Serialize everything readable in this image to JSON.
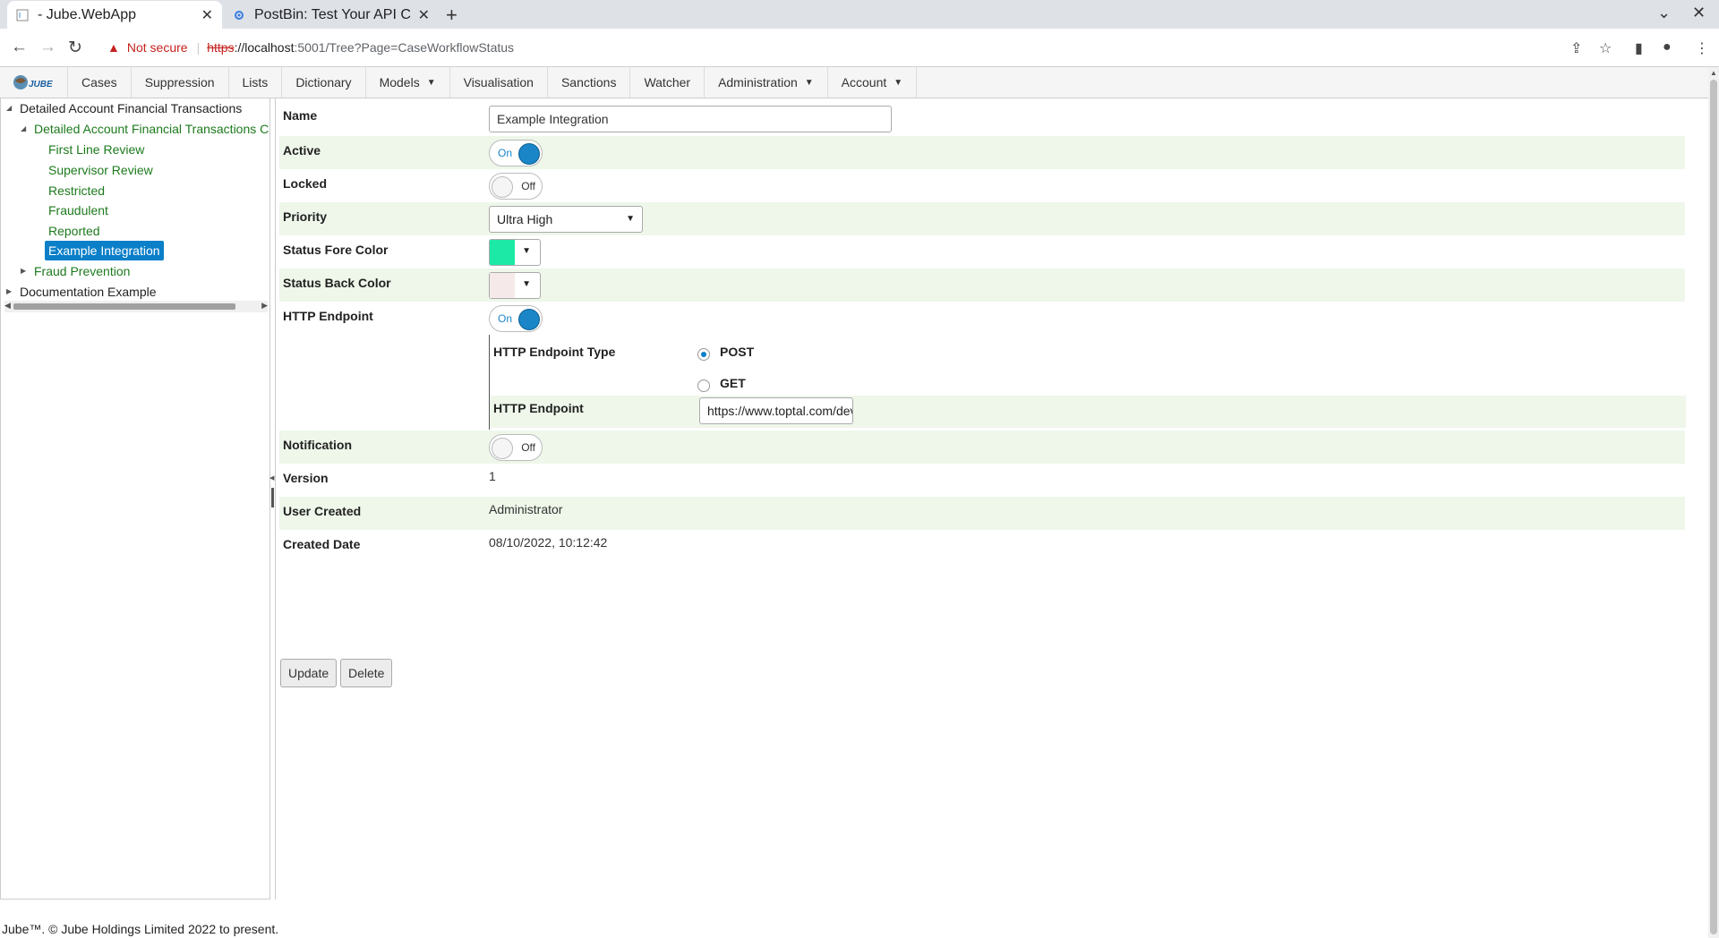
{
  "browser": {
    "tabs": [
      {
        "title": "- Jube.WebApp",
        "active": true
      },
      {
        "title": "PostBin: Test Your API Clie",
        "active": false
      }
    ],
    "warning": "Not secure",
    "url_scheme": "https",
    "url_host": "://localhost",
    "url_rest": ":5001/Tree?Page=CaseWorkflowStatus"
  },
  "menu": {
    "logo_text": "JUBE",
    "items": [
      {
        "label": "Cases",
        "dropdown": false
      },
      {
        "label": "Suppression",
        "dropdown": false
      },
      {
        "label": "Lists",
        "dropdown": false
      },
      {
        "label": "Dictionary",
        "dropdown": false
      },
      {
        "label": "Models",
        "dropdown": true
      },
      {
        "label": "Visualisation",
        "dropdown": false
      },
      {
        "label": "Sanctions",
        "dropdown": false
      },
      {
        "label": "Watcher",
        "dropdown": false
      },
      {
        "label": "Administration",
        "dropdown": true
      },
      {
        "label": "Account",
        "dropdown": true
      }
    ]
  },
  "tree": {
    "root": "Detailed Account Financial Transactions",
    "child": "Detailed Account Financial Transactions Ca",
    "leaves": [
      "First Line Review",
      "Supervisor Review",
      "Restricted",
      "Fraudulent",
      "Reported",
      "Example Integration"
    ],
    "selected": "Example Integration",
    "sibling": "Fraud Prevention",
    "root2": "Documentation Example"
  },
  "form": {
    "name_label": "Name",
    "name_value": "Example Integration",
    "active_label": "Active",
    "active_state": "On",
    "locked_label": "Locked",
    "locked_state": "Off",
    "priority_label": "Priority",
    "priority_value": "Ultra High",
    "fore_label": "Status Fore Color",
    "fore_color": "#1de9a6",
    "back_label": "Status Back Color",
    "back_color": "#f6e9e9",
    "http_label": "HTTP Endpoint",
    "http_state": "On",
    "http_type_label": "HTTP Endpoint Type",
    "post_label": "POST",
    "get_label": "GET",
    "http_endpoint_label": "HTTP Endpoint",
    "http_endpoint_value": "https://www.toptal.com/developers/postbin",
    "notification_label": "Notification",
    "notification_state": "Off",
    "version_label": "Version",
    "version_value": "1",
    "user_label": "User Created",
    "user_value": "Administrator",
    "date_label": "Created Date",
    "date_value": "08/10/2022, 10:12:42",
    "update_button": "Update",
    "delete_button": "Delete"
  },
  "footer": "Jube™. © Jube Holdings Limited 2022 to present."
}
